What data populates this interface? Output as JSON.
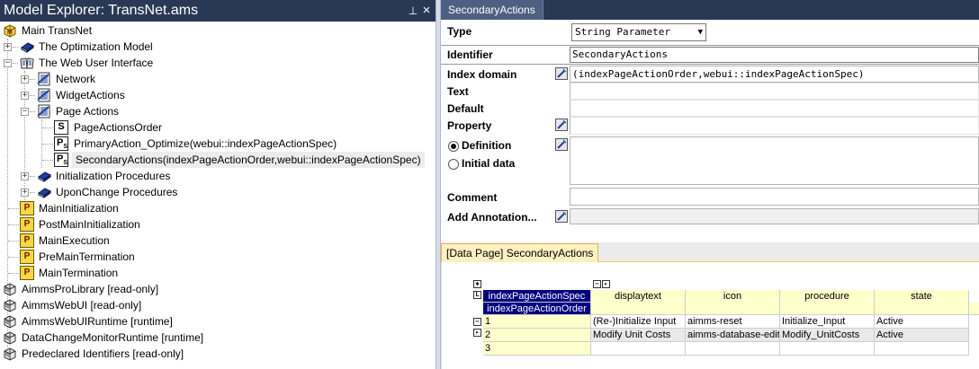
{
  "explorer": {
    "title": "Model Explorer: TransNet.ams",
    "pin_glyph": "⊥",
    "close_glyph": "×",
    "items": [
      {
        "label": "Main TransNet",
        "icon": "main-model-icon"
      },
      {
        "label": "The Optimization Model",
        "icon": "book-icon"
      },
      {
        "label": "The Web User Interface",
        "icon": "open-book-icon"
      },
      {
        "label": "Network",
        "icon": "section-icon"
      },
      {
        "label": "WidgetActions",
        "icon": "section-icon"
      },
      {
        "label": "Page Actions",
        "icon": "section-icon"
      },
      {
        "label": "PageActionsOrder",
        "icon": "set-icon"
      },
      {
        "label": "PrimaryAction_Optimize(webui::indexPageActionSpec)",
        "icon": "string-parameter-icon"
      },
      {
        "label": "SecondaryActions(indexPageActionOrder,webui::indexPageActionSpec)",
        "icon": "string-parameter-icon"
      },
      {
        "label": "Initialization Procedures",
        "icon": "book-icon"
      },
      {
        "label": "UponChange Procedures",
        "icon": "book-icon"
      },
      {
        "label": "MainInitialization",
        "icon": "procedure-icon"
      },
      {
        "label": "PostMainInitialization",
        "icon": "procedure-icon"
      },
      {
        "label": "MainExecution",
        "icon": "procedure-icon"
      },
      {
        "label": "PreMainTermination",
        "icon": "procedure-icon"
      },
      {
        "label": "MainTermination",
        "icon": "procedure-icon"
      },
      {
        "label": "AimmsProLibrary [read-only]",
        "icon": "library-icon"
      },
      {
        "label": "AimmsWebUI [read-only]",
        "icon": "library-icon"
      },
      {
        "label": "AimmsWebUIRuntime [runtime]",
        "icon": "library-icon"
      },
      {
        "label": "DataChangeMonitorRuntime [runtime]",
        "icon": "library-icon"
      },
      {
        "label": "Predeclared Identifiers [read-only]",
        "icon": "library-icon"
      }
    ]
  },
  "attributes": {
    "tab": "SecondaryActions",
    "type_label": "Type",
    "type_value": "String Parameter",
    "identifier_label": "Identifier",
    "identifier_value": "SecondaryActions",
    "index_domain_label": "Index domain",
    "index_domain_value": "(indexPageActionOrder,webui::indexPageActionSpec)",
    "text_label": "Text",
    "default_label": "Default",
    "property_label": "Property",
    "definition_label": "Definition",
    "initial_data_label": "Initial data",
    "comment_label": "Comment",
    "add_annotation_label": "Add Annotation..."
  },
  "datapage": {
    "tab": "[Data Page] SecondaryActions",
    "index_headers": [
      "indexPageActionSpec",
      "indexPageActionOrder"
    ],
    "columns": [
      "displaytext",
      "icon",
      "procedure",
      "state"
    ],
    "rows": [
      {
        "key": "1",
        "cells": [
          "(Re-)Initialize Input",
          "aimms-reset",
          "Initialize_Input",
          "Active"
        ]
      },
      {
        "key": "2",
        "cells": [
          "Modify Unit Costs",
          "aimms-database-edit",
          "Modify_UnitCosts",
          "Active"
        ]
      },
      {
        "key": "3",
        "cells": [
          "",
          "",
          "",
          ""
        ]
      }
    ]
  }
}
